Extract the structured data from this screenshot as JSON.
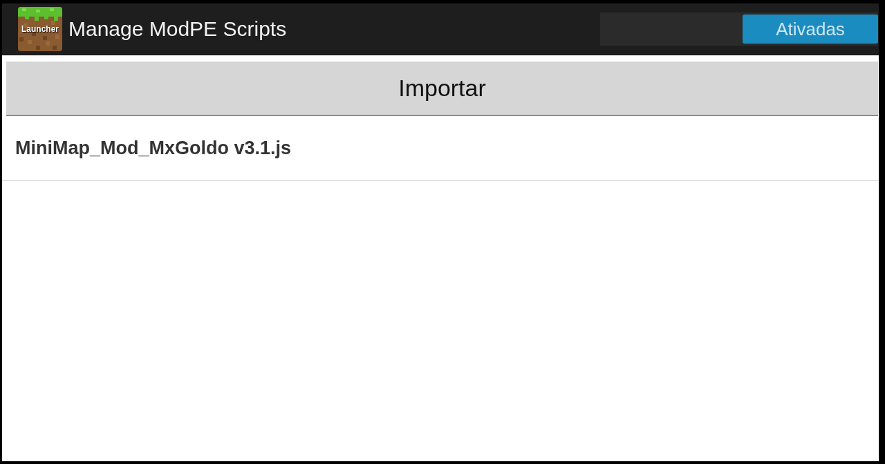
{
  "action_bar": {
    "app_icon_label": "Launcher",
    "title": "Manage ModPE Scripts",
    "toggle": {
      "label": "Ativadas",
      "on": true
    }
  },
  "import_button": {
    "label": "Importar"
  },
  "scripts": [
    {
      "name": "MiniMap_Mod_MxGoldo v3.1.js"
    }
  ]
}
